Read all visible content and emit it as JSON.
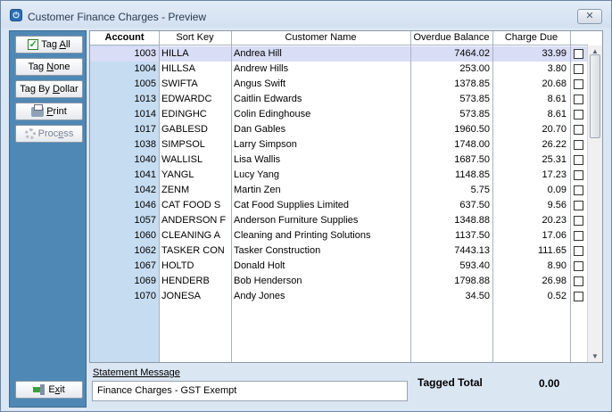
{
  "window": {
    "title": "Customer Finance Charges - Preview",
    "close_label": "✕"
  },
  "sidebar": {
    "tag_all": {
      "prefix": "Tag ",
      "hot": "A",
      "suffix": "ll"
    },
    "tag_none": {
      "prefix": "Tag ",
      "hot": "N",
      "suffix": "one"
    },
    "tag_by_dollar": {
      "prefix": "Tag By ",
      "hot": "D",
      "suffix": "ollar"
    },
    "print": {
      "prefix": "",
      "hot": "P",
      "suffix": "rint"
    },
    "process": {
      "prefix": "Proc",
      "hot": "e",
      "suffix": "ss"
    },
    "exit": {
      "prefix": "E",
      "hot": "x",
      "suffix": "it"
    }
  },
  "table": {
    "columns": [
      "Account",
      "Sort Key",
      "Customer Name",
      "Overdue Balance",
      "Charge Due"
    ],
    "selected_row": 0,
    "rows": [
      {
        "account": "1003",
        "sort_key": "HILLA",
        "name": "Andrea Hill",
        "balance": "7464.02",
        "charge": "33.99"
      },
      {
        "account": "1004",
        "sort_key": "HILLSA",
        "name": "Andrew Hills",
        "balance": "253.00",
        "charge": "3.80"
      },
      {
        "account": "1005",
        "sort_key": "SWIFTA",
        "name": "Angus Swift",
        "balance": "1378.85",
        "charge": "20.68"
      },
      {
        "account": "1013",
        "sort_key": "EDWARDC",
        "name": "Caitlin Edwards",
        "balance": "573.85",
        "charge": "8.61"
      },
      {
        "account": "1014",
        "sort_key": "EDINGHC",
        "name": "Colin Edinghouse",
        "balance": "573.85",
        "charge": "8.61"
      },
      {
        "account": "1017",
        "sort_key": "GABLESD",
        "name": "Dan Gables",
        "balance": "1960.50",
        "charge": "20.70"
      },
      {
        "account": "1038",
        "sort_key": "SIMPSOL",
        "name": "Larry Simpson",
        "balance": "1748.00",
        "charge": "26.22"
      },
      {
        "account": "1040",
        "sort_key": "WALLISL",
        "name": "Lisa Wallis",
        "balance": "1687.50",
        "charge": "25.31"
      },
      {
        "account": "1041",
        "sort_key": "YANGL",
        "name": "Lucy Yang",
        "balance": "1148.85",
        "charge": "17.23"
      },
      {
        "account": "1042",
        "sort_key": "ZENM",
        "name": "Martin Zen",
        "balance": "5.75",
        "charge": "0.09"
      },
      {
        "account": "1046",
        "sort_key": "CAT FOOD S",
        "name": "Cat Food Supplies Limited",
        "balance": "637.50",
        "charge": "9.56"
      },
      {
        "account": "1057",
        "sort_key": "ANDERSON F",
        "name": "Anderson Furniture Supplies",
        "balance": "1348.88",
        "charge": "20.23"
      },
      {
        "account": "1060",
        "sort_key": "CLEANING A",
        "name": "Cleaning and Printing Solutions",
        "balance": "1137.50",
        "charge": "17.06"
      },
      {
        "account": "1062",
        "sort_key": "TASKER CON",
        "name": "Tasker Construction",
        "balance": "7443.13",
        "charge": "111.65"
      },
      {
        "account": "1067",
        "sort_key": "HOLTD",
        "name": "Donald Holt",
        "balance": "593.40",
        "charge": "8.90"
      },
      {
        "account": "1069",
        "sort_key": "HENDERB",
        "name": "Bob Henderson",
        "balance": "1798.88",
        "charge": "26.98"
      },
      {
        "account": "1070",
        "sort_key": "JONESA",
        "name": "Andy Jones",
        "balance": "34.50",
        "charge": "0.52"
      }
    ]
  },
  "statement": {
    "label": "Statement Message",
    "value": "Finance Charges - GST Exempt"
  },
  "totals": {
    "label": "Tagged Total",
    "value": "0.00"
  },
  "colors": {
    "sidebar": "#4f88b5",
    "account_column": "#c6dcf1",
    "selected_row": "#d9ddf6"
  }
}
